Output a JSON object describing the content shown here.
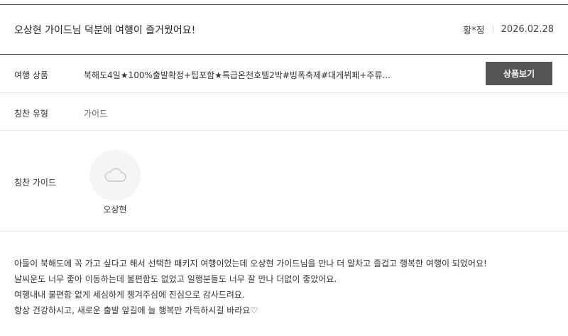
{
  "review": {
    "title": "오상현 가이드님 덕분에 여행이 즐거웠어요!",
    "author": "황*정",
    "date": "2026.02.28"
  },
  "product": {
    "label": "여행 상품",
    "name": "북해도4일★100%출발확정+팁포함★특급온천호텔2박#빙폭축제#대게뷔페+주류...",
    "button_label": "상품보기"
  },
  "praise_type": {
    "label": "칭찬 유형",
    "value": "가이드"
  },
  "guide": {
    "label": "칭찬 가이드",
    "name": "오상현",
    "avatar_icon": "cloud-placeholder-icon"
  },
  "body": {
    "lines": [
      "아들이 북해도에 꼭 가고 싶다고 해서 선택한 패키지 여행이었는데 오상현 가이드님을 만나 더 알차고 즐겁고 행복한 여행이 되었어요!",
      "날씨운도 너무 좋아 이동하는데 불편함도 없었고 일행분들도 너무 잘 만나 더없이 좋았어요.",
      "여행내내 불편함 없게 세심하게 챙겨주심에 진심으로 감사드려요.",
      "항상 건강하시고, 새로운 출발 앞길에 늘 행복만 가득하시길 바라요♡"
    ]
  },
  "colors": {
    "button_bg": "#555555",
    "rule_dark": "#4a4a4a",
    "rule_light": "#e8e8e8",
    "avatar_bg": "#f5f5f5"
  }
}
